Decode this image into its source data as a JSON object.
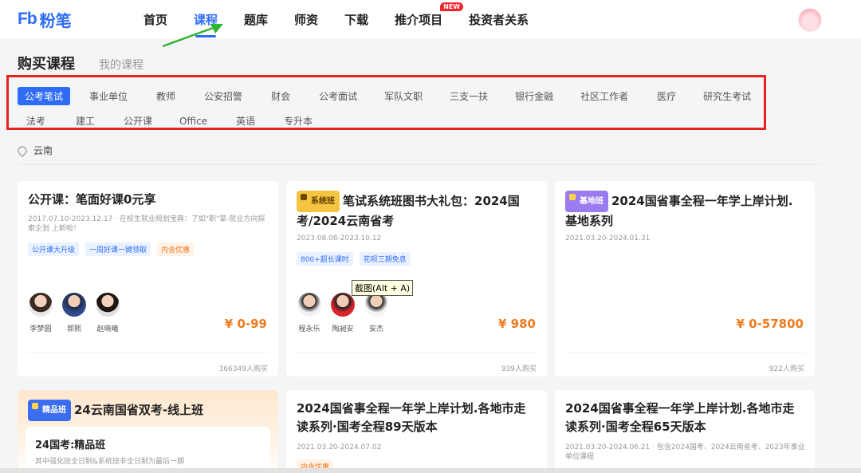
{
  "header": {
    "logo_mark": "Fb",
    "logo_text": "粉笔",
    "nav": [
      {
        "label": "首页"
      },
      {
        "label": "课程",
        "active": true
      },
      {
        "label": "题库"
      },
      {
        "label": "师资"
      },
      {
        "label": "下载"
      },
      {
        "label": "推介项目",
        "badge": "NEW"
      },
      {
        "label": "投资者关系"
      }
    ]
  },
  "page_tabs": {
    "active": "购买课程",
    "other": "我的课程"
  },
  "categories": {
    "row1": [
      "公考笔试",
      "事业单位",
      "教师",
      "公安招警",
      "财会",
      "公考面试",
      "军队文职",
      "三支一扶",
      "银行金融",
      "社区工作者",
      "医疗",
      "研究生考试"
    ],
    "row2": [
      "法考",
      "建工",
      "公开课",
      "Office",
      "英语",
      "专升本"
    ],
    "active": "公考笔试"
  },
  "location": "云南",
  "tooltip": "截图(Alt + A)",
  "cards": [
    {
      "title": "公开课：笔面好课0元享",
      "meta": "2017.07.10-2023.12.17 · 在校生就业规划宝典：了如\"职\"掌-就业方向探索企划 上新啦！",
      "tags": [
        "公开课大升级",
        "一周好课一键领取",
        "内含优惠"
      ],
      "teachers": [
        "李梦圆",
        "郭熙",
        "赵晓曦"
      ],
      "price": "¥ 0-99",
      "sold": "366349人购买"
    },
    {
      "badge": "系统班",
      "title": "笔试系统班图书大礼包：2024国考/2024云南省考",
      "meta": "2023.08.08-2023.10.12",
      "tags": [
        "800+超长课时",
        "花呗三期免息"
      ],
      "teachers": [
        "程永乐",
        "陶昶安",
        "安杰"
      ],
      "price": "¥ 980",
      "sold": "939人购买"
    },
    {
      "badge": "基地班",
      "title": "2024国省事全程一年学上岸计划.基地系列",
      "meta": "2021.03.20-2024.01.31",
      "price": "¥ 0-57800",
      "sold": "922人购买"
    },
    {
      "badge": "精品班",
      "title": "24云南国省双考-线上班",
      "subtitle": "24国考:精品班",
      "meta": "其中强化班全日制&系统班非全日制为最后一期"
    },
    {
      "title": "2024国省事全程一年学上岸计划.各地市走读系列·国考全程89天版本",
      "meta": "2021.03.20-2024.07.02",
      "tags": [
        "内含优惠"
      ]
    },
    {
      "title": "2024国省事全程一年学上岸计划.各地市走读系列·国考全程65天版本",
      "meta": "2021.03.20-2024.06.21 · 包含2024国考、2024云南省考、2023年事业单位课程"
    }
  ],
  "colors": {
    "brand": "#2f6cf6",
    "price": "#f07a1e",
    "highlight_box": "#e6231e",
    "arrow": "#2fb52f"
  }
}
